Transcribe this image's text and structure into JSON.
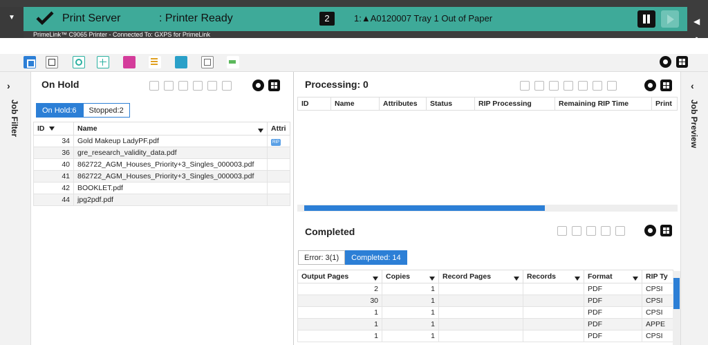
{
  "status": {
    "title": "Print Server",
    "state": ": Printer Ready",
    "count": "2",
    "alert": "1:▲A0120007 Tray 1 Out of Paper",
    "printer_line": "PrimeLink™ C9065 Printer - Connected To: GXPS for PrimeLink"
  },
  "left_side": {
    "label": "Job Filter"
  },
  "right_side": {
    "label": "Job Preview"
  },
  "on_hold": {
    "title": "On Hold",
    "tabs": [
      "On Hold:6",
      "Stopped:2"
    ],
    "columns": [
      "ID",
      "Name",
      "Attri"
    ],
    "rows": [
      {
        "id": "34",
        "name": "Gold Makeup LadyPF.pdf",
        "attr": "RIP"
      },
      {
        "id": "36",
        "name": "gre_research_validity_data.pdf",
        "attr": ""
      },
      {
        "id": "40",
        "name": "862722_AGM_Houses_Priority+3_Singles_000003.pdf",
        "attr": ""
      },
      {
        "id": "41",
        "name": "862722_AGM_Houses_Priority+3_Singles_000003.pdf",
        "attr": ""
      },
      {
        "id": "42",
        "name": "BOOKLET.pdf",
        "attr": ""
      },
      {
        "id": "44",
        "name": "jpg2pdf.pdf",
        "attr": ""
      }
    ]
  },
  "processing": {
    "title": "Processing: 0",
    "columns": [
      "ID",
      "Name",
      "Attributes",
      "Status",
      "RIP Processing",
      "Remaining RIP Time",
      "Print"
    ]
  },
  "completed": {
    "title": "Completed",
    "tabs": [
      "Error: 3(1)",
      "Completed: 14"
    ],
    "columns": [
      "Output Pages",
      "Copies",
      "Record Pages",
      "Records",
      "Format",
      "RIP Ty"
    ],
    "rows": [
      {
        "output_pages": "2",
        "copies": "1",
        "record_pages": "",
        "records": "",
        "format": "PDF",
        "rip_type": "CPSI"
      },
      {
        "output_pages": "30",
        "copies": "1",
        "record_pages": "",
        "records": "",
        "format": "PDF",
        "rip_type": "CPSI"
      },
      {
        "output_pages": "1",
        "copies": "1",
        "record_pages": "",
        "records": "",
        "format": "PDF",
        "rip_type": "CPSI"
      },
      {
        "output_pages": "1",
        "copies": "1",
        "record_pages": "",
        "records": "",
        "format": "PDF",
        "rip_type": "APPE"
      },
      {
        "output_pages": "1",
        "copies": "1",
        "record_pages": "",
        "records": "",
        "format": "PDF",
        "rip_type": "CPSI"
      }
    ]
  },
  "colors": {
    "status_bg": "#3eaa99",
    "accent": "#2c7fd6",
    "chrome": "#3d3d3d"
  },
  "icons": [
    "menu-icon",
    "check-icon",
    "pause-icon",
    "play-icon",
    "gear-icon",
    "grid-icon",
    "filter-icon"
  ]
}
